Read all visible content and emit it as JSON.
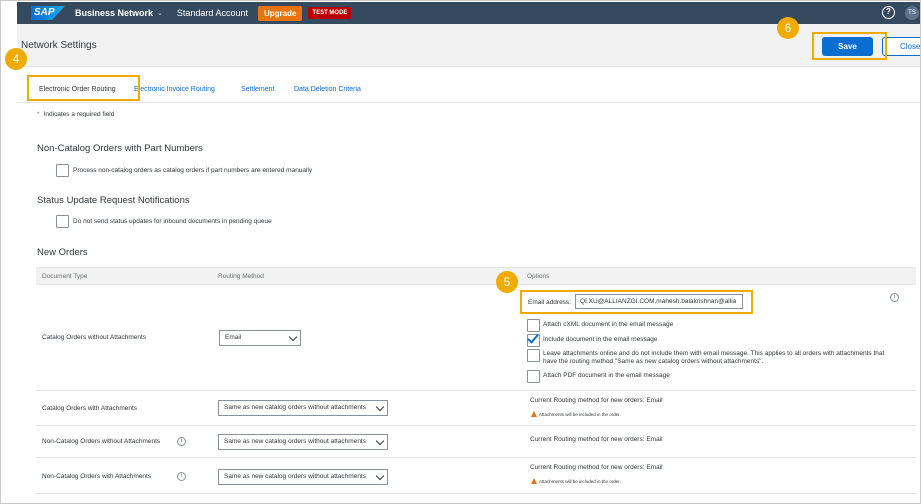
{
  "shell": {
    "product": "SAP",
    "app_title": "Business Network",
    "app_caret": "⌄",
    "account": "Standard Account",
    "upgrade_label": "Upgrade",
    "test_mode_label": "TEST MODE",
    "help_glyph": "?",
    "avatar_initials": "TS"
  },
  "header": {
    "title": "Network Settings",
    "save_label": "Save",
    "close_label": "Close"
  },
  "tabs": [
    {
      "label": "Electronic Order Routing"
    },
    {
      "label": "Electronic Invoice Routing"
    },
    {
      "label": "Settlement"
    },
    {
      "label": "Data Deletion Criteria"
    }
  ],
  "required_note": {
    "star": "*",
    "text": "Indicates a required field"
  },
  "sections": {
    "non_catalog": {
      "title": "Non-Catalog Orders with Part Numbers",
      "checkbox_label": "Process non-catalog orders as catalog orders if part numbers are entered manually"
    },
    "status_update": {
      "title": "Status Update Request Notifications",
      "checkbox_label": "Do not send status updates for inbound documents in pending queue"
    },
    "new_orders": {
      "title": "New Orders"
    }
  },
  "table": {
    "headers": {
      "document_type": "Document Type",
      "routing_method": "Routing Method",
      "options": "Options"
    },
    "row1": {
      "document_type": "Catalog Orders without Attachments",
      "routing_method": "Email",
      "email_label": "Email address:",
      "email_value": "QI.XU@ALLIANZGI.COM,mahesh.balakrishnan@allia",
      "options": [
        {
          "label": "Attach cXML document in the email message",
          "checked": false
        },
        {
          "label": "Include document in the email message",
          "checked": true
        },
        {
          "label": "Leave attachments online and do not include them with email message.  This applies to all orders with attachments that",
          "checked": false
        },
        {
          "label": "have the routing method \"Same as new catalog orders without attachments\".",
          "checked": false
        },
        {
          "label": "Attach PDF document in the email message",
          "checked": false
        }
      ]
    },
    "row2": {
      "document_type": "Catalog Orders with Attachments",
      "routing_method": "Same as new catalog orders without attachments",
      "current": "Current Routing method for new orders: Email",
      "note": "Attachments will be included in the order."
    },
    "row3": {
      "document_type": "Non-Catalog Orders without Attachments",
      "routing_method": "Same as new catalog orders without attachments",
      "current": "Current Routing method for new orders: Email"
    },
    "row4": {
      "document_type": "Non-Catalog Orders with Attachments",
      "routing_method": "Same as new catalog orders without attachments",
      "current": "Current Routing method for new orders: Email",
      "note": "Attachments will be included in the order."
    }
  },
  "callouts": {
    "c4": "4",
    "c5": "5",
    "c6": "6"
  },
  "icons": {
    "info": "i"
  },
  "colors": {
    "shell": "#354a5f",
    "accent": "#0a6ed1",
    "callout": "#f0ab00",
    "upgrade": "#e9730c",
    "test_mode": "#bb0000"
  }
}
